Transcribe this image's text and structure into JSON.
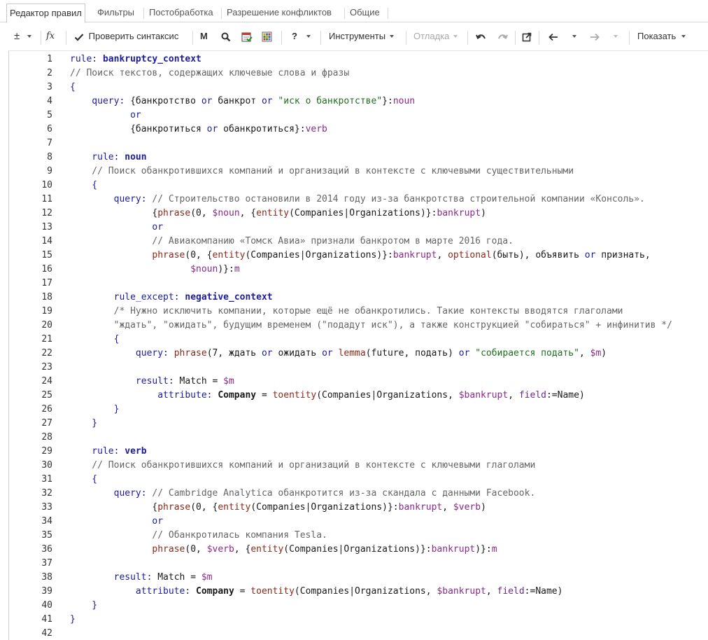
{
  "tabs": [
    {
      "label": "Редактор правил",
      "active": true
    },
    {
      "label": "Фильтры"
    },
    {
      "label": "Постобработка"
    },
    {
      "label": "Разрешение конфликтов"
    },
    {
      "label": "Общие"
    }
  ],
  "toolbar": {
    "plusminus": "±",
    "fx": "fx",
    "check_syntax": "Проверить синтаксис",
    "m_label": "M",
    "help": "?",
    "tools": "Инструменты",
    "debug": "Отладка",
    "show": "Показать"
  },
  "code_lines": [
    [
      {
        "t": "rule: ",
        "c": "kw"
      },
      {
        "t": "bankruptcy_context",
        "c": "name"
      }
    ],
    [
      {
        "t": "// Поиск текстов, содержащих ключевые слова и фразы",
        "c": "cm"
      }
    ],
    [
      {
        "t": "{",
        "c": "kw"
      }
    ],
    [
      {
        "t": "    query: ",
        "c": "kw"
      },
      {
        "t": "{банкротство ",
        "c": "op"
      },
      {
        "t": "or",
        "c": "kw"
      },
      {
        "t": " банкрот ",
        "c": "op"
      },
      {
        "t": "or",
        "c": "kw"
      },
      {
        "t": " \"иск о банкротстве\"",
        "c": "str"
      },
      {
        "t": "}:",
        "c": "op"
      },
      {
        "t": "noun",
        "c": "var"
      }
    ],
    [
      {
        "t": "           or",
        "c": "kw"
      }
    ],
    [
      {
        "t": "           {банкротиться ",
        "c": "op"
      },
      {
        "t": "or",
        "c": "kw"
      },
      {
        "t": " обанкротиться}:",
        "c": "op"
      },
      {
        "t": "verb",
        "c": "var"
      }
    ],
    [],
    [
      {
        "t": "    rule: ",
        "c": "kw"
      },
      {
        "t": "noun",
        "c": "name"
      }
    ],
    [
      {
        "t": "    // Поиск обанкротившихся компаний и организаций в контексте с ключевыми существительными",
        "c": "cm"
      }
    ],
    [
      {
        "t": "    {",
        "c": "kw"
      }
    ],
    [
      {
        "t": "        query: ",
        "c": "kw"
      },
      {
        "t": "// Строительство остановили в 2014 году из-за банкротства строительной компании «Консоль».",
        "c": "cm"
      }
    ],
    [
      {
        "t": "               {",
        "c": "op"
      },
      {
        "t": "phrase",
        "c": "fn"
      },
      {
        "t": "(0, ",
        "c": "op"
      },
      {
        "t": "$noun",
        "c": "var"
      },
      {
        "t": ", {",
        "c": "op"
      },
      {
        "t": "entity",
        "c": "fn"
      },
      {
        "t": "(Companies|Organizations)}:",
        "c": "op"
      },
      {
        "t": "bankrupt",
        "c": "var"
      },
      {
        "t": ")",
        "c": "op"
      }
    ],
    [
      {
        "t": "               or",
        "c": "kw"
      }
    ],
    [
      {
        "t": "               // Авиакомпанию «Томск Авиа» признали банкротом в марте 2016 года.",
        "c": "cm"
      }
    ],
    [
      {
        "t": "               ",
        "c": "op"
      },
      {
        "t": "phrase",
        "c": "fn"
      },
      {
        "t": "(0, {",
        "c": "op"
      },
      {
        "t": "entity",
        "c": "fn"
      },
      {
        "t": "(Companies|Organizations)}:",
        "c": "op"
      },
      {
        "t": "bankrupt",
        "c": "var"
      },
      {
        "t": ", ",
        "c": "op"
      },
      {
        "t": "optional",
        "c": "fn"
      },
      {
        "t": "(быть), объявить ",
        "c": "op"
      },
      {
        "t": "or",
        "c": "kw"
      },
      {
        "t": " признать,",
        "c": "op"
      }
    ],
    [
      {
        "t": "                      ",
        "c": "op"
      },
      {
        "t": "$noun",
        "c": "var"
      },
      {
        "t": ")}:",
        "c": "op"
      },
      {
        "t": "m",
        "c": "var"
      }
    ],
    [],
    [
      {
        "t": "        rule_except: ",
        "c": "kw"
      },
      {
        "t": "negative_context",
        "c": "name"
      }
    ],
    [
      {
        "t": "        /* Нужно исключить компании, которые ещё не обанкротились. Такие контексты вводятся глаголами",
        "c": "cm"
      }
    ],
    [
      {
        "t": "        \"ждать\", \"ожидать\", будущим временем (\"подадут иск\"), а также конструкцией \"собираться\" + инфинитив */",
        "c": "cm"
      }
    ],
    [
      {
        "t": "        {",
        "c": "kw"
      }
    ],
    [
      {
        "t": "            query: ",
        "c": "kw"
      },
      {
        "t": "phrase",
        "c": "fn"
      },
      {
        "t": "(7, ждать ",
        "c": "op"
      },
      {
        "t": "or",
        "c": "kw"
      },
      {
        "t": " ожидать ",
        "c": "op"
      },
      {
        "t": "or",
        "c": "kw"
      },
      {
        "t": " ",
        "c": "op"
      },
      {
        "t": "lemma",
        "c": "fn"
      },
      {
        "t": "(future, подать) ",
        "c": "op"
      },
      {
        "t": "or",
        "c": "kw"
      },
      {
        "t": " \"собирается подать\"",
        "c": "str"
      },
      {
        "t": ", ",
        "c": "op"
      },
      {
        "t": "$m",
        "c": "var"
      },
      {
        "t": ")",
        "c": "op"
      }
    ],
    [],
    [
      {
        "t": "            result: ",
        "c": "kw"
      },
      {
        "t": "Match = ",
        "c": "op"
      },
      {
        "t": "$m",
        "c": "var"
      }
    ],
    [
      {
        "t": "                attribute: ",
        "c": "kw"
      },
      {
        "t": "Company",
        "c": "bold"
      },
      {
        "t": " = ",
        "c": "op"
      },
      {
        "t": "toentity",
        "c": "fn"
      },
      {
        "t": "(Companies|Organizations, ",
        "c": "op"
      },
      {
        "t": "$bankrupt",
        "c": "var"
      },
      {
        "t": ", ",
        "c": "op"
      },
      {
        "t": "field",
        "c": "fld"
      },
      {
        "t": ":=Name)",
        "c": "op"
      }
    ],
    [
      {
        "t": "        }",
        "c": "kw"
      }
    ],
    [
      {
        "t": "    }",
        "c": "kw"
      }
    ],
    [],
    [
      {
        "t": "    rule: ",
        "c": "kw"
      },
      {
        "t": "verb",
        "c": "name"
      }
    ],
    [
      {
        "t": "    // Поиск обанкротившихся компаний и организаций в контексте с ключевыми глаголами",
        "c": "cm"
      }
    ],
    [
      {
        "t": "    {",
        "c": "kw"
      }
    ],
    [
      {
        "t": "        query: ",
        "c": "kw"
      },
      {
        "t": "// Cambridge Analytica обанкротится из-за скандала с данными Facebook.",
        "c": "cm"
      }
    ],
    [
      {
        "t": "               {",
        "c": "op"
      },
      {
        "t": "phrase",
        "c": "fn"
      },
      {
        "t": "(0, {",
        "c": "op"
      },
      {
        "t": "entity",
        "c": "fn"
      },
      {
        "t": "(Companies|Organizations)}:",
        "c": "op"
      },
      {
        "t": "bankrupt",
        "c": "var"
      },
      {
        "t": ", ",
        "c": "op"
      },
      {
        "t": "$verb",
        "c": "var"
      },
      {
        "t": ")",
        "c": "op"
      }
    ],
    [
      {
        "t": "               or",
        "c": "kw"
      }
    ],
    [
      {
        "t": "               // Обанкротилась компания Tesla.",
        "c": "cm"
      }
    ],
    [
      {
        "t": "               ",
        "c": "op"
      },
      {
        "t": "phrase",
        "c": "fn"
      },
      {
        "t": "(0, ",
        "c": "op"
      },
      {
        "t": "$verb",
        "c": "var"
      },
      {
        "t": ", {",
        "c": "op"
      },
      {
        "t": "entity",
        "c": "fn"
      },
      {
        "t": "(Companies|Organizations)}:",
        "c": "op"
      },
      {
        "t": "bankrupt",
        "c": "var"
      },
      {
        "t": ")}:",
        "c": "op"
      },
      {
        "t": "m",
        "c": "var"
      }
    ],
    [],
    [
      {
        "t": "        result: ",
        "c": "kw"
      },
      {
        "t": "Match = ",
        "c": "op"
      },
      {
        "t": "$m",
        "c": "var"
      }
    ],
    [
      {
        "t": "            attribute: ",
        "c": "kw"
      },
      {
        "t": "Company",
        "c": "bold"
      },
      {
        "t": " = ",
        "c": "op"
      },
      {
        "t": "toentity",
        "c": "fn"
      },
      {
        "t": "(Companies|Organizations, ",
        "c": "op"
      },
      {
        "t": "$bankrupt",
        "c": "var"
      },
      {
        "t": ", ",
        "c": "op"
      },
      {
        "t": "field",
        "c": "fld"
      },
      {
        "t": ":=Name)",
        "c": "op"
      }
    ],
    [
      {
        "t": "    }",
        "c": "kw"
      }
    ],
    [
      {
        "t": "}",
        "c": "kw"
      }
    ],
    []
  ]
}
